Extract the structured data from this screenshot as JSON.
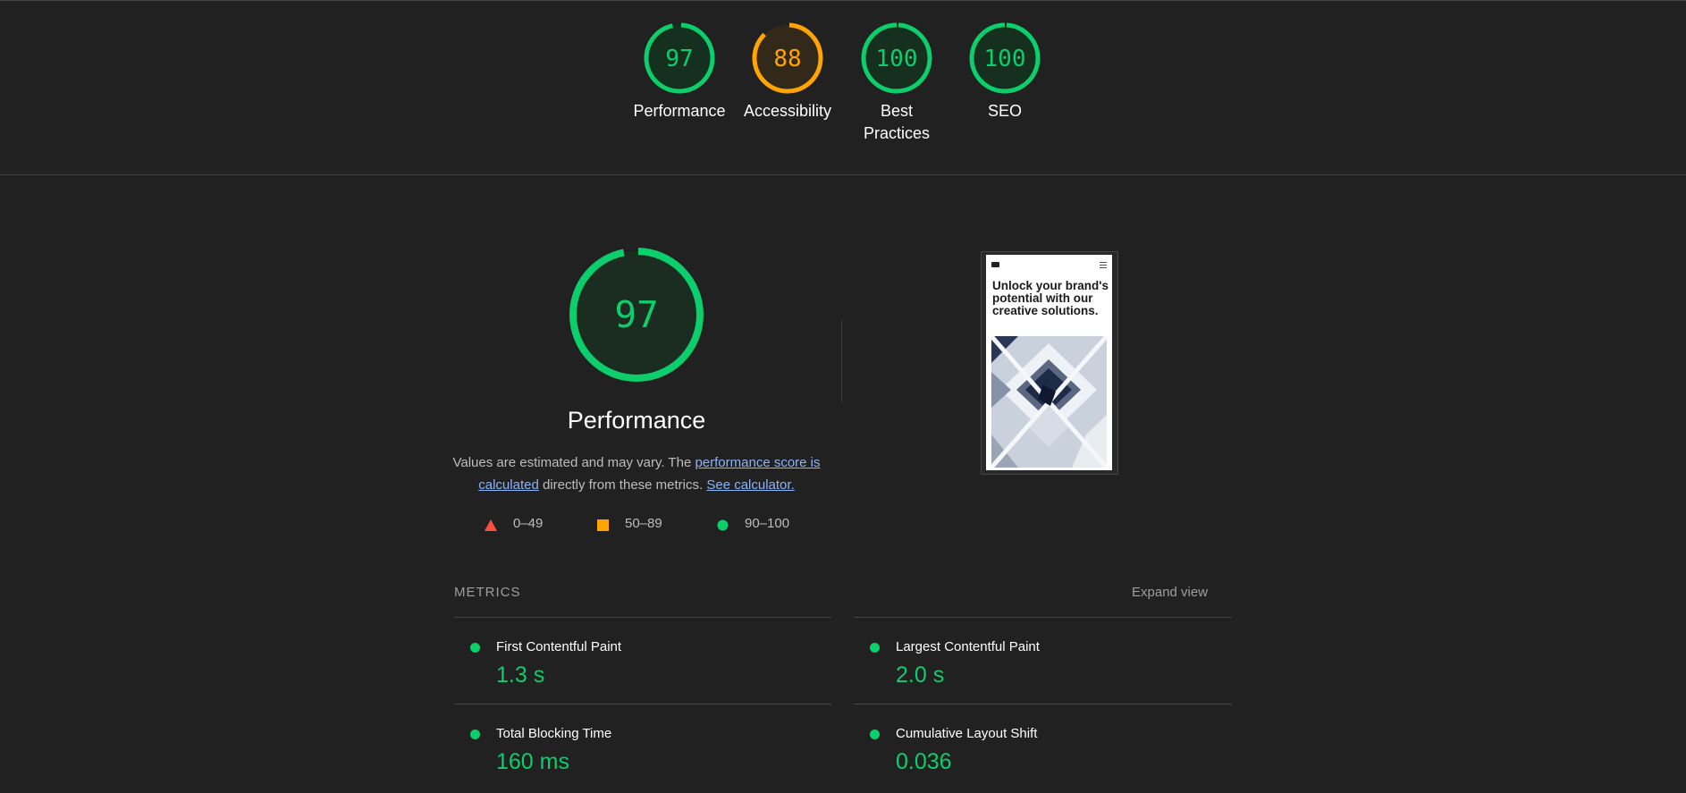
{
  "colors": {
    "pass": "#0cce6b",
    "average": "#ffa400",
    "fail": "#ff4e42",
    "background": "#212121",
    "link": "#8ab4f8"
  },
  "summary_gauges": [
    {
      "score": 97,
      "label": "Performance",
      "status": "pass"
    },
    {
      "score": 88,
      "label": "Accessibility",
      "status": "average"
    },
    {
      "score": 100,
      "label": "Best Practices",
      "status": "pass"
    },
    {
      "score": 100,
      "label": "SEO",
      "status": "pass"
    }
  ],
  "performance": {
    "score": 97,
    "status": "pass",
    "title": "Performance",
    "desc_prefix": "Values are estimated and may vary. The ",
    "desc_link1": "performance score is calculated",
    "desc_middle": " directly from these metrics. ",
    "desc_link2": "See calculator."
  },
  "legend": [
    {
      "shape": "triangle-icon",
      "range": "0–49",
      "status": "fail"
    },
    {
      "shape": "square-icon",
      "range": "50–89",
      "status": "average"
    },
    {
      "shape": "circle-icon",
      "range": "90–100",
      "status": "pass"
    }
  ],
  "screenshot": {
    "headline": "Unlock your brand's potential with our creative solutions."
  },
  "metrics": {
    "heading": "METRICS",
    "expand_label": "Expand view",
    "items": [
      {
        "name": "First Contentful Paint",
        "value": "1.3 s",
        "status": "pass"
      },
      {
        "name": "Largest Contentful Paint",
        "value": "2.0 s",
        "status": "pass"
      },
      {
        "name": "Total Blocking Time",
        "value": "160 ms",
        "status": "pass"
      },
      {
        "name": "Cumulative Layout Shift",
        "value": "0.036",
        "status": "pass"
      }
    ]
  }
}
